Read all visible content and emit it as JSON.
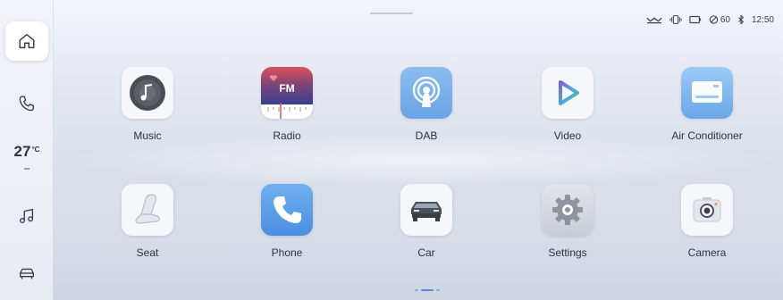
{
  "status_bar": {
    "signal_value": "60",
    "time": "12:50"
  },
  "sidebar": {
    "temperature": "27",
    "temperature_unit": "°C",
    "items": [
      {
        "icon": "home-icon",
        "active": true
      },
      {
        "icon": "phone-icon",
        "active": false
      },
      {
        "icon": "music-note-icon",
        "active": false
      },
      {
        "icon": "car-icon",
        "active": false
      }
    ]
  },
  "apps": [
    {
      "label": "Music",
      "icon": "music-icon"
    },
    {
      "label": "Radio",
      "icon": "radio-fm-icon",
      "badge": "FM"
    },
    {
      "label": "DAB",
      "icon": "dab-icon"
    },
    {
      "label": "Video",
      "icon": "video-play-icon"
    },
    {
      "label": "Air Conditioner",
      "icon": "air-conditioner-icon"
    },
    {
      "label": "Seat",
      "icon": "seat-icon"
    },
    {
      "label": "Phone",
      "icon": "phone-handset-icon"
    },
    {
      "label": "Car",
      "icon": "car-front-icon"
    },
    {
      "label": "Settings",
      "icon": "settings-gear-icon"
    },
    {
      "label": "Camera",
      "icon": "camera-icon"
    }
  ],
  "colors": {
    "accent": "#5f86d6",
    "radio_top": "#e0505a",
    "radio_bottom": "#3d3f8f",
    "dab": "#7fb2ea",
    "video_play": "#5aa7e8",
    "air_conditioner": "#7eb8ee",
    "phone": "#5a9de6"
  },
  "pagination": {
    "current_page": 2,
    "pages": 3
  }
}
